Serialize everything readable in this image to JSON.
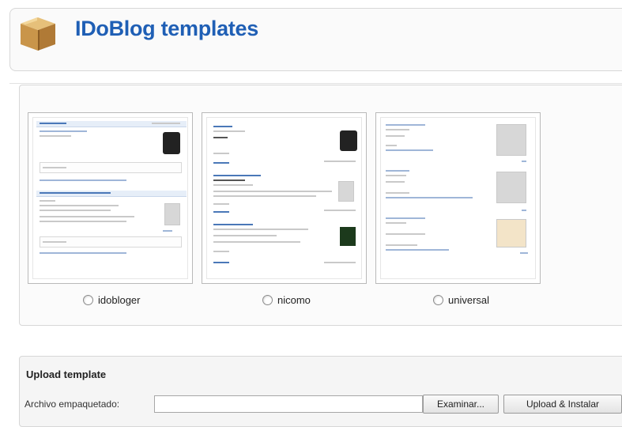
{
  "header": {
    "title": "IDoBlog templates",
    "icon": "package-box-icon"
  },
  "templates": [
    {
      "label": "idobloger",
      "selected": false
    },
    {
      "label": "nicomo",
      "selected": false
    },
    {
      "label": "universal",
      "selected": false
    }
  ],
  "upload": {
    "title": "Upload template",
    "file_label": "Archivo empaquetado:",
    "file_value": "",
    "browse_label": "Examinar...",
    "submit_label": "Upload & Instalar"
  },
  "colors": {
    "title": "#1f5fb5",
    "panel_border": "#d7d7d7"
  }
}
